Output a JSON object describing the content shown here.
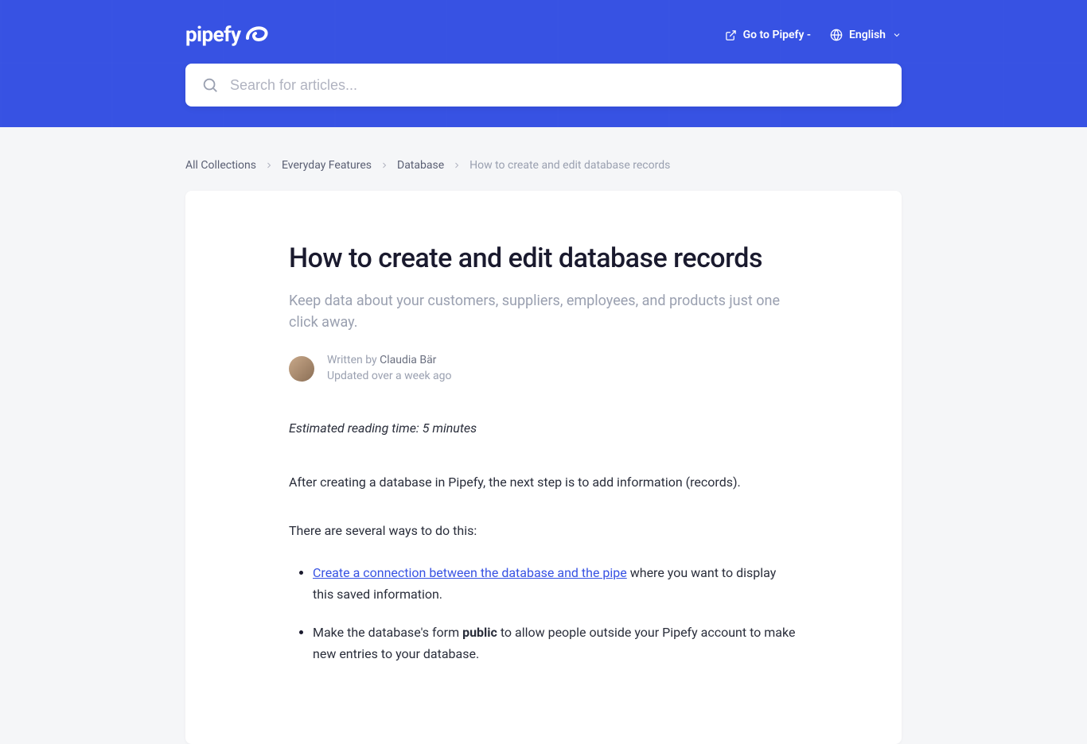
{
  "brand": {
    "name": "pipefy"
  },
  "header": {
    "go_to_label": "Go to Pipefy -",
    "language_label": "English"
  },
  "search": {
    "placeholder": "Search for articles..."
  },
  "breadcrumbs": {
    "items": [
      {
        "label": "All Collections"
      },
      {
        "label": "Everyday Features"
      },
      {
        "label": "Database"
      }
    ],
    "current": "How to create and edit database records"
  },
  "article": {
    "title": "How to create and edit database records",
    "subtitle": "Keep data about your customers, suppliers, employees, and products just one click away.",
    "written_by_prefix": "Written by ",
    "author": "Claudia Bär",
    "updated": "Updated over a week ago",
    "reading_time": "Estimated reading time: 5 minutes",
    "intro": "After creating a database in Pipefy, the next step is to add information (records).",
    "lead_in": "There are several ways to do this:",
    "ways": [
      {
        "link": "Create a connection between the database and the pipe",
        "rest": " where you want to display this saved information."
      },
      {
        "pre": "Make the database's form ",
        "bold": "public",
        "rest": " to allow people outside your Pipefy account to make new entries to your database."
      }
    ]
  }
}
